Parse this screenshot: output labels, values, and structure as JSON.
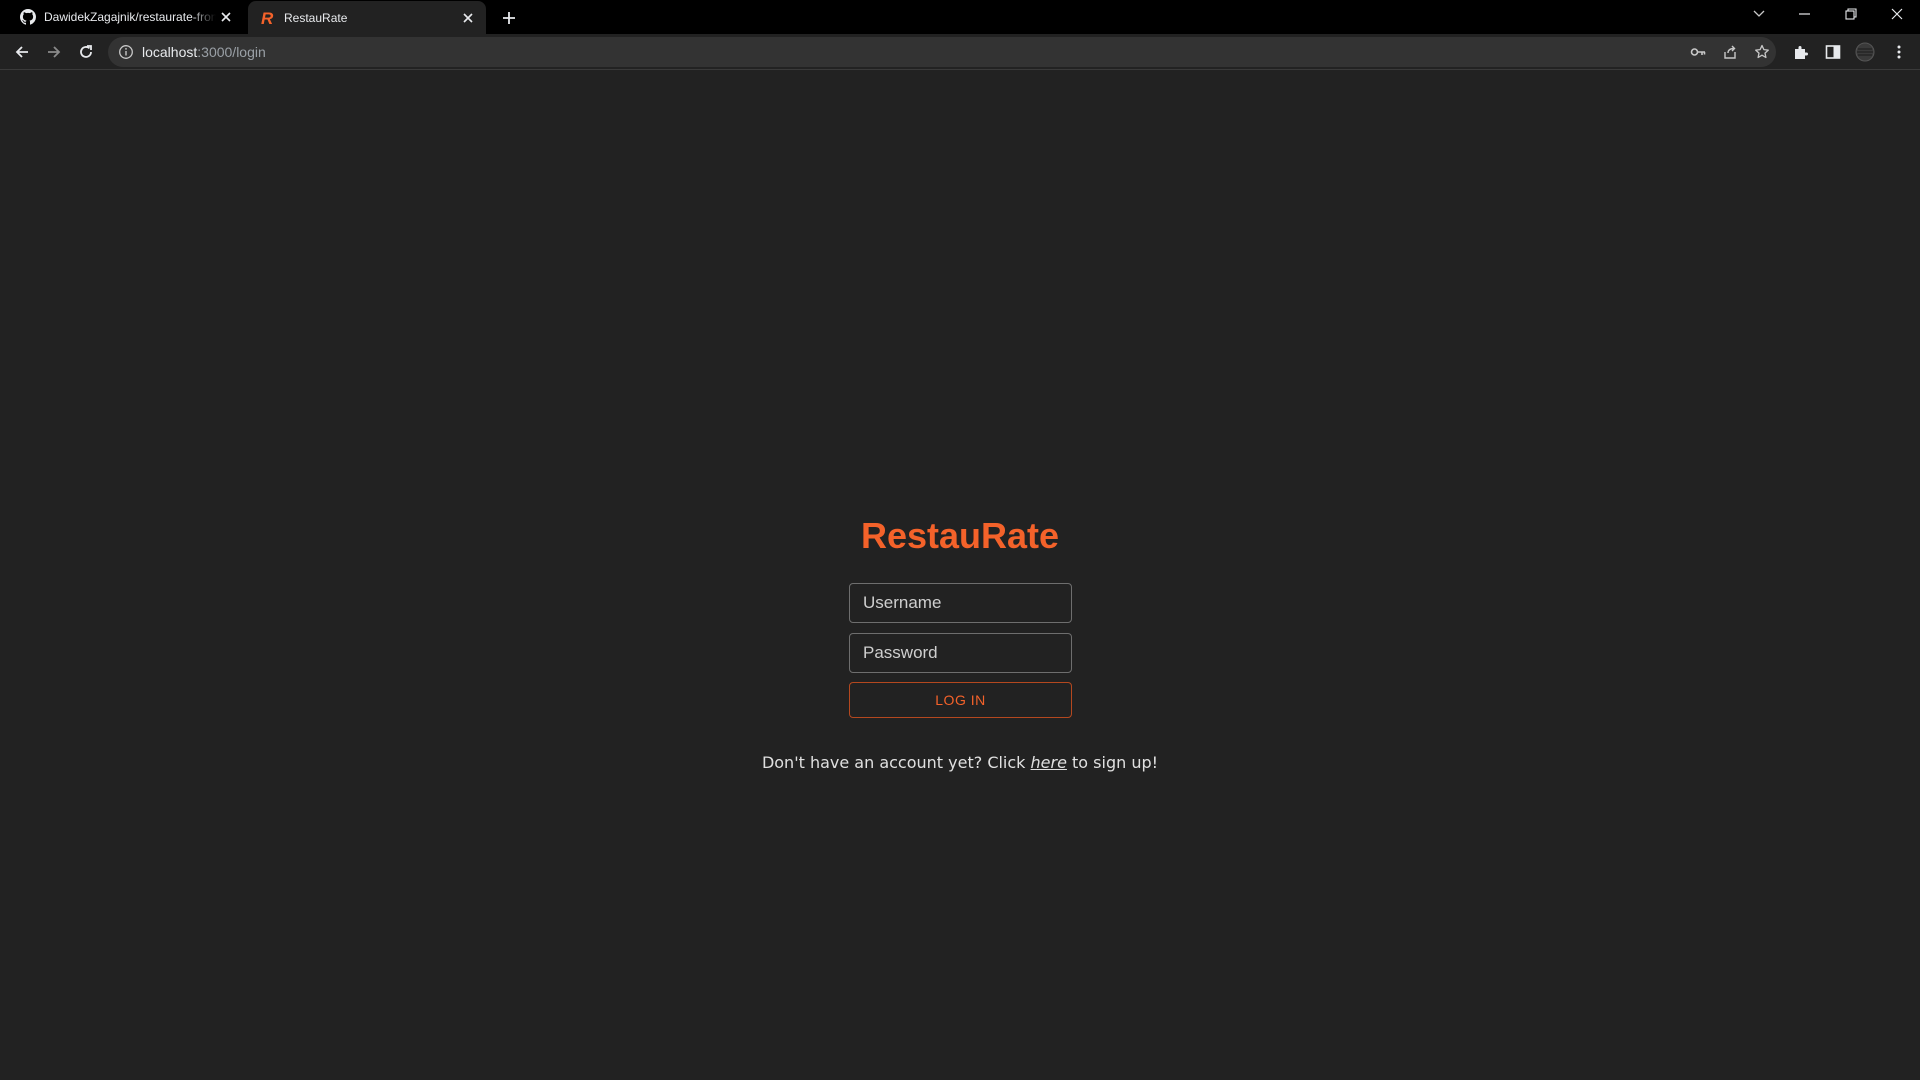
{
  "browser": {
    "tabs": [
      {
        "title": "DawidekZagajnik/restaurate-frontend",
        "favicon": "github-icon",
        "active": false
      },
      {
        "title": "RestauRate",
        "favicon": "restaurate-r-icon",
        "active": true
      }
    ],
    "address": {
      "host": "localhost",
      "path": ":3000/login"
    }
  },
  "app": {
    "brand": "RestauRate",
    "brand_color": "#f4622a",
    "username_placeholder": "Username",
    "password_placeholder": "Password",
    "login_label": "LOG IN",
    "signup_prefix": "Don't have an account yet? Click ",
    "signup_link": "here",
    "signup_suffix": " to sign up!"
  }
}
